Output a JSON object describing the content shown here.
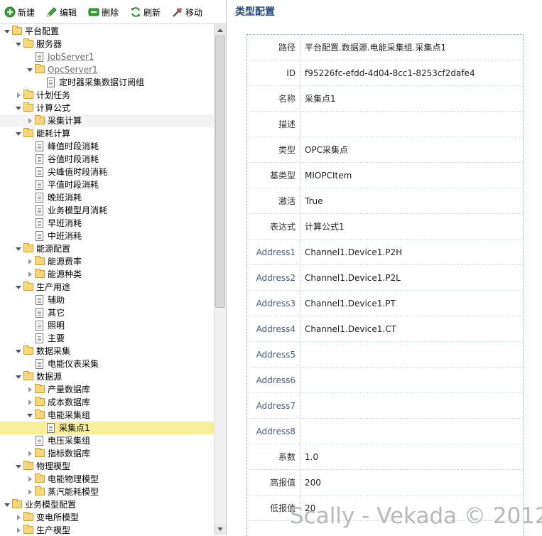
{
  "toolbar": {
    "new": "新建",
    "edit": "编辑",
    "delete": "删除",
    "refresh": "刷新",
    "move": "移动"
  },
  "tree": [
    {
      "label": "平台配置",
      "level": 0,
      "type": "folder",
      "state": "open"
    },
    {
      "label": "服务器",
      "level": 1,
      "type": "folder",
      "state": "open"
    },
    {
      "label": "JobServer1",
      "level": 2,
      "type": "doc",
      "link": true
    },
    {
      "label": "OpcServer1",
      "level": 2,
      "type": "folder",
      "state": "open",
      "link": true
    },
    {
      "label": "定时器采集数据订阅组",
      "level": 3,
      "type": "doc"
    },
    {
      "label": "计划任务",
      "level": 1,
      "type": "folder",
      "state": "closed"
    },
    {
      "label": "计算公式",
      "level": 1,
      "type": "folder",
      "state": "open"
    },
    {
      "label": "采集计算",
      "level": 2,
      "type": "folder",
      "state": "closed",
      "hover": true
    },
    {
      "label": "能耗计算",
      "level": 1,
      "type": "folder",
      "state": "open"
    },
    {
      "label": "峰值时段消耗",
      "level": 2,
      "type": "doc"
    },
    {
      "label": "谷值时段消耗",
      "level": 2,
      "type": "doc"
    },
    {
      "label": "尖峰值时段消耗",
      "level": 2,
      "type": "doc"
    },
    {
      "label": "平值时段消耗",
      "level": 2,
      "type": "doc"
    },
    {
      "label": "晚班消耗",
      "level": 2,
      "type": "doc"
    },
    {
      "label": "业务模型月消耗",
      "level": 2,
      "type": "doc"
    },
    {
      "label": "早班消耗",
      "level": 2,
      "type": "doc"
    },
    {
      "label": "中班消耗",
      "level": 2,
      "type": "doc"
    },
    {
      "label": "能源配置",
      "level": 1,
      "type": "folder",
      "state": "open"
    },
    {
      "label": "能源费率",
      "level": 2,
      "type": "folder",
      "state": "closed"
    },
    {
      "label": "能源种类",
      "level": 2,
      "type": "folder",
      "state": "closed"
    },
    {
      "label": "生产用途",
      "level": 1,
      "type": "folder",
      "state": "open"
    },
    {
      "label": "辅助",
      "level": 2,
      "type": "doc"
    },
    {
      "label": "其它",
      "level": 2,
      "type": "doc"
    },
    {
      "label": "照明",
      "level": 2,
      "type": "doc"
    },
    {
      "label": "主要",
      "level": 2,
      "type": "doc"
    },
    {
      "label": "数据采集",
      "level": 1,
      "type": "folder",
      "state": "open"
    },
    {
      "label": "电能仪表采集",
      "level": 2,
      "type": "doc"
    },
    {
      "label": "数据源",
      "level": 1,
      "type": "folder",
      "state": "open"
    },
    {
      "label": "产量数据库",
      "level": 2,
      "type": "folder",
      "state": "closed"
    },
    {
      "label": "成本数据库",
      "level": 2,
      "type": "folder",
      "state": "closed"
    },
    {
      "label": "电能采集组",
      "level": 2,
      "type": "folder",
      "state": "open"
    },
    {
      "label": "采集点1",
      "level": 3,
      "type": "doc",
      "selected": true
    },
    {
      "label": "电压采集组",
      "level": 2,
      "type": "doc"
    },
    {
      "label": "指标数据库",
      "level": 2,
      "type": "folder",
      "state": "closed"
    },
    {
      "label": "物理模型",
      "level": 1,
      "type": "folder",
      "state": "open"
    },
    {
      "label": "电能物理模型",
      "level": 2,
      "type": "folder",
      "state": "closed"
    },
    {
      "label": "蒸汽能耗模型",
      "level": 2,
      "type": "folder",
      "state": "closed"
    },
    {
      "label": "业务模型配置",
      "level": 0,
      "type": "folder",
      "state": "open"
    },
    {
      "label": "变电所模型",
      "level": 1,
      "type": "folder",
      "state": "closed"
    },
    {
      "label": "生产模型",
      "level": 1,
      "type": "folder",
      "state": "closed"
    }
  ],
  "panel": {
    "title": "类型配置"
  },
  "properties": [
    {
      "key": "路径",
      "value": "平台配置.数据源.电能采集组.采集点1"
    },
    {
      "key": "ID",
      "value": "f95226fc-efdd-4d04-8cc1-8253cf2dafe4"
    },
    {
      "key": "名称",
      "value": "采集点1"
    },
    {
      "key": "描述",
      "value": ""
    },
    {
      "key": "类型",
      "value": "OPC采集点"
    },
    {
      "key": "基类型",
      "value": "MIOPCItem"
    },
    {
      "key": "激活",
      "value": "True"
    },
    {
      "key": "表达式",
      "value": "计算公式1"
    },
    {
      "key": "Address1",
      "value": "Channel1.Device1.P2H"
    },
    {
      "key": "Address2",
      "value": "Channel1.Device1.P2L"
    },
    {
      "key": "Address3",
      "value": "Channel1.Device1.PT"
    },
    {
      "key": "Address4",
      "value": "Channel1.Device1.CT"
    },
    {
      "key": "Address5",
      "value": ""
    },
    {
      "key": "Address6",
      "value": ""
    },
    {
      "key": "Address7",
      "value": ""
    },
    {
      "key": "Address8",
      "value": ""
    },
    {
      "key": "系数",
      "value": "1.0"
    },
    {
      "key": "高报值",
      "value": "200"
    },
    {
      "key": "低报值",
      "value": "20"
    }
  ],
  "watermark": "Scally - Vekada © 2012",
  "colors": {
    "selected_row": "#f7ee9c",
    "title": "#2a4a80",
    "table_border": "#8aa6cc"
  }
}
